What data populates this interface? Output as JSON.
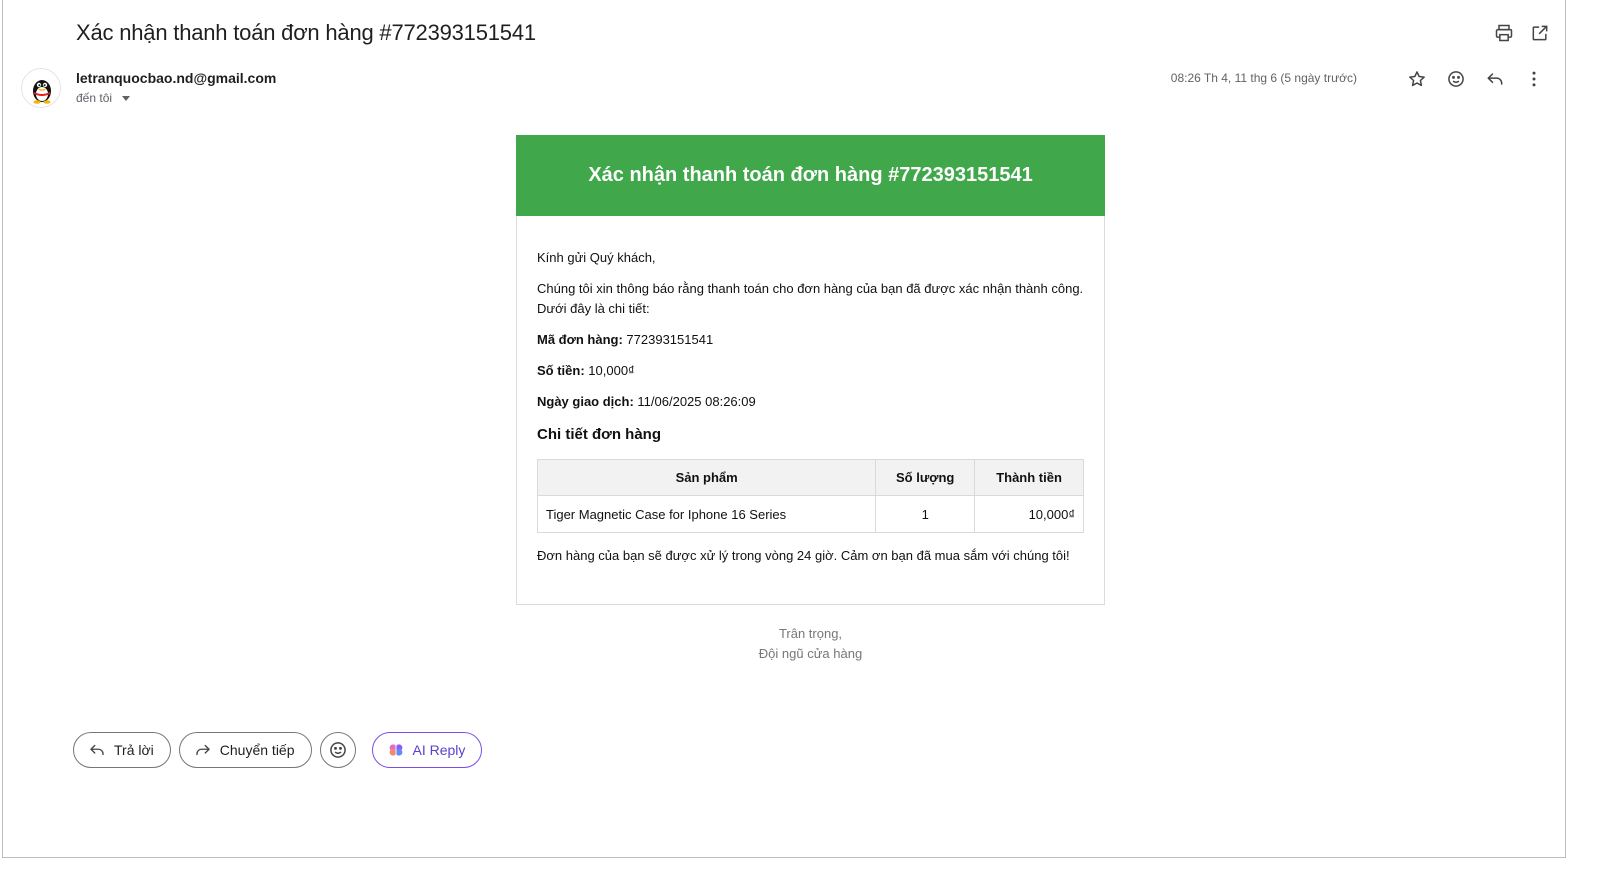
{
  "email": {
    "subject": "Xác nhận thanh toán đơn hàng #772393151541",
    "sender": "letranquocbao.nd@gmail.com",
    "to_label": "đến tôi",
    "date": "08:26 Th 4, 11 thg 6 (5 ngày trước)"
  },
  "message": {
    "banner_title": "Xác nhận thanh toán đơn hàng #772393151541",
    "greeting": "Kính gửi Quý khách,",
    "intro": "Chúng tôi xin thông báo rằng thanh toán cho đơn hàng của bạn đã được xác nhận thành công. Dưới đây là chi tiết:",
    "order_id_label": "Mã đơn hàng:",
    "order_id_value": "772393151541",
    "amount_label": "Số tiền:",
    "amount_value": "10,000₫",
    "date_label": "Ngày giao dịch:",
    "date_value": "11/06/2025 08:26:09",
    "details_heading": "Chi tiết đơn hàng",
    "table": {
      "headers": [
        "Sản phẩm",
        "Số lượng",
        "Thành tiền"
      ],
      "rows": [
        [
          "Tiger Magnetic Case for Iphone 16 Series",
          "1",
          "10,000₫"
        ]
      ]
    },
    "footer_note": "Đơn hàng của bạn sẽ được xử lý trong vòng 24 giờ. Cảm ơn bạn đã mua sắm với chúng tôi!",
    "closing_line1": "Trân trọng,",
    "closing_line2": "Đội ngũ cửa hàng",
    "banner_color": "#40a84b"
  },
  "actions": {
    "reply": "Trả lời",
    "forward": "Chuyển tiếp",
    "ai_reply": "AI Reply"
  },
  "icons": [
    "print-icon",
    "open-in-new-icon",
    "star-icon",
    "emoji-icon",
    "reply-icon",
    "more-vert-icon",
    "forward-icon",
    "brain-icon"
  ]
}
